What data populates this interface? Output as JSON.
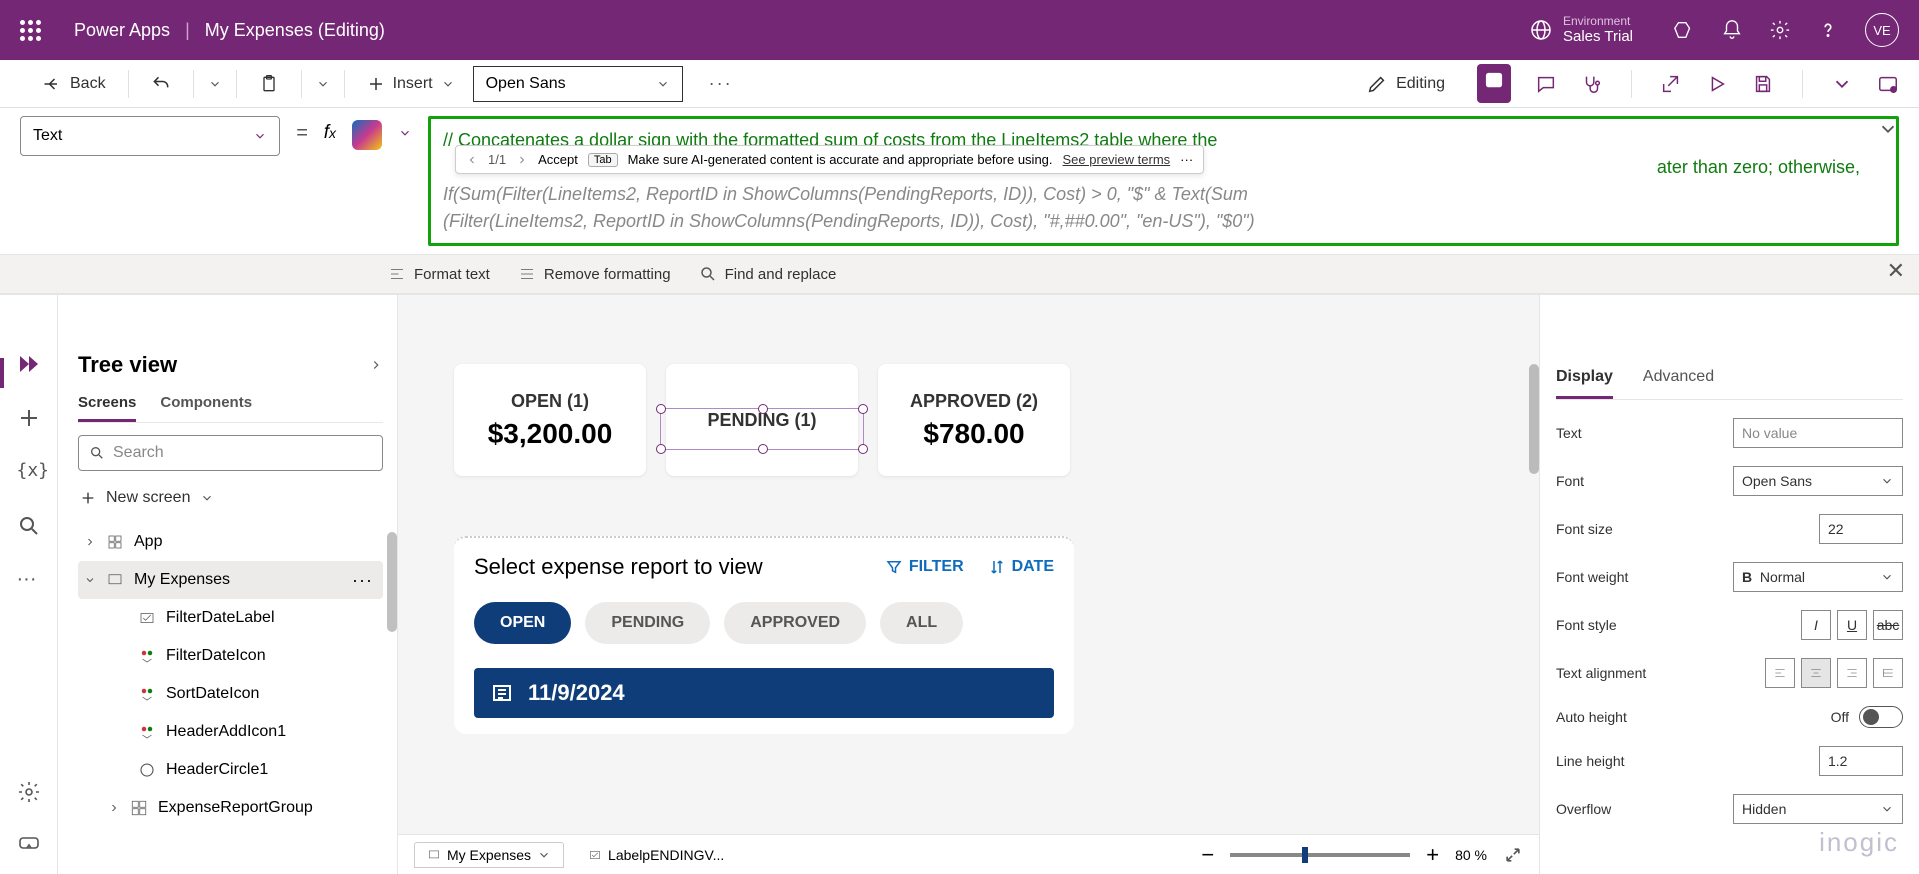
{
  "header": {
    "app_name": "Power Apps",
    "breadcrumb": "My Expenses (Editing)",
    "env_label": "Environment",
    "env_name": "Sales Trial",
    "avatar": "VE"
  },
  "toolbar": {
    "back": "Back",
    "insert": "Insert",
    "font": "Open Sans",
    "editing": "Editing"
  },
  "formula": {
    "property": "Text",
    "comment": "// Concatenates a dollar sign with the formatted sum of costs from the LineItems2 table where the",
    "comment2_left": "",
    "comment2_right": "ater than zero; otherwise,",
    "suggestion1": "If(Sum(Filter(LineItems2, ReportID in ShowColumns(PendingReports, ID)), Cost) > 0, \"$\" & Text(Sum",
    "suggestion2": "(Filter(LineItems2, ReportID in ShowColumns(PendingReports, ID)), Cost), \"#,##0.00\", \"en-US\"), \"$0\")",
    "tip_counter": "1/1",
    "tip_accept": "Accept",
    "tip_key": "Tab",
    "tip_text": "Make sure AI-generated content is accurate and appropriate before using.",
    "tip_link": "See preview terms"
  },
  "format_bar": {
    "format_text": "Format text",
    "remove_formatting": "Remove formatting",
    "find_replace": "Find and replace"
  },
  "tree": {
    "title": "Tree view",
    "tabs": {
      "screens": "Screens",
      "components": "Components"
    },
    "search_placeholder": "Search",
    "new_screen": "New screen",
    "items": [
      {
        "label": "App"
      },
      {
        "label": "My Expenses"
      },
      {
        "label": "FilterDateLabel"
      },
      {
        "label": "FilterDateIcon"
      },
      {
        "label": "SortDateIcon"
      },
      {
        "label": "HeaderAddIcon1"
      },
      {
        "label": "HeaderCircle1"
      },
      {
        "label": "ExpenseReportGroup"
      }
    ]
  },
  "canvas": {
    "cards": [
      {
        "title": "OPEN (1)",
        "amount": "$3,200.00"
      },
      {
        "title": "PENDING (1)",
        "amount": ""
      },
      {
        "title": "APPROVED (2)",
        "amount": "$780.00"
      }
    ],
    "report_title": "Select expense report to view",
    "filter": "FILTER",
    "date_sort": "DATE",
    "pills": [
      "OPEN",
      "PENDING",
      "APPROVED",
      "ALL"
    ],
    "date_item": "11/9/2024",
    "bottom_tab": "My Expenses",
    "bottom_crumb": "LabelpENDINGV...",
    "zoom": "80  %"
  },
  "props": {
    "tabs": {
      "display": "Display",
      "advanced": "Advanced"
    },
    "text_label": "Text",
    "text_value": "No value",
    "font_label": "Font",
    "font_value": "Open Sans",
    "fontsize_label": "Font size",
    "fontsize_value": "22",
    "fontweight_label": "Font weight",
    "fontweight_value": "Normal",
    "fontstyle_label": "Font style",
    "textalign_label": "Text alignment",
    "autoheight_label": "Auto height",
    "autoheight_value": "Off",
    "lineheight_label": "Line height",
    "lineheight_value": "1.2",
    "overflow_label": "Overflow",
    "overflow_value": "Hidden"
  },
  "watermark": "inogic"
}
